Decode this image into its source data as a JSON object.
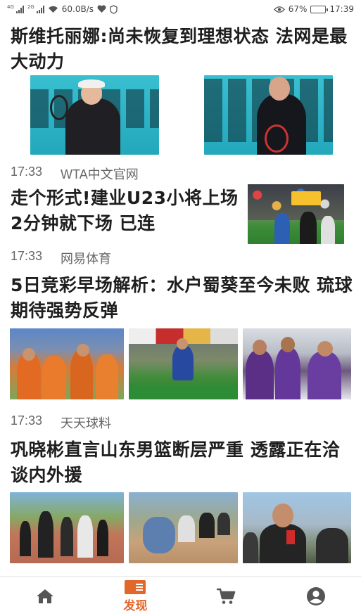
{
  "status_bar": {
    "signal_tag_1": "4G",
    "signal_tag_2": "2G",
    "network_speed": "60.0B/s",
    "battery": "67%",
    "battery_level": 0.67,
    "time": "17:39"
  },
  "feed": {
    "articles": [
      {
        "title": "斯维托丽娜:尚未恢复到理想状态 法网是最大动力",
        "time": "17:33",
        "source": "WTA中文官网"
      },
      {
        "title": "走个形式!建业U23小将上场2分钟就下场 已连",
        "time": "17:33",
        "source": "网易体育"
      },
      {
        "title": "5日竞彩早场解析：水户蜀葵至今未败 琉球期待强势反弹",
        "time": "17:33",
        "source": "天天球料"
      },
      {
        "title": "巩晓彬直言山东男篮断层严重 透露正在洽谈内外援"
      }
    ]
  },
  "bottom_nav": {
    "items": [
      {
        "icon": "home-icon"
      },
      {
        "icon": "discover-icon",
        "label": "发现",
        "active": true
      },
      {
        "icon": "cart-icon"
      },
      {
        "icon": "profile-icon"
      }
    ],
    "accent": "#e2672a"
  }
}
